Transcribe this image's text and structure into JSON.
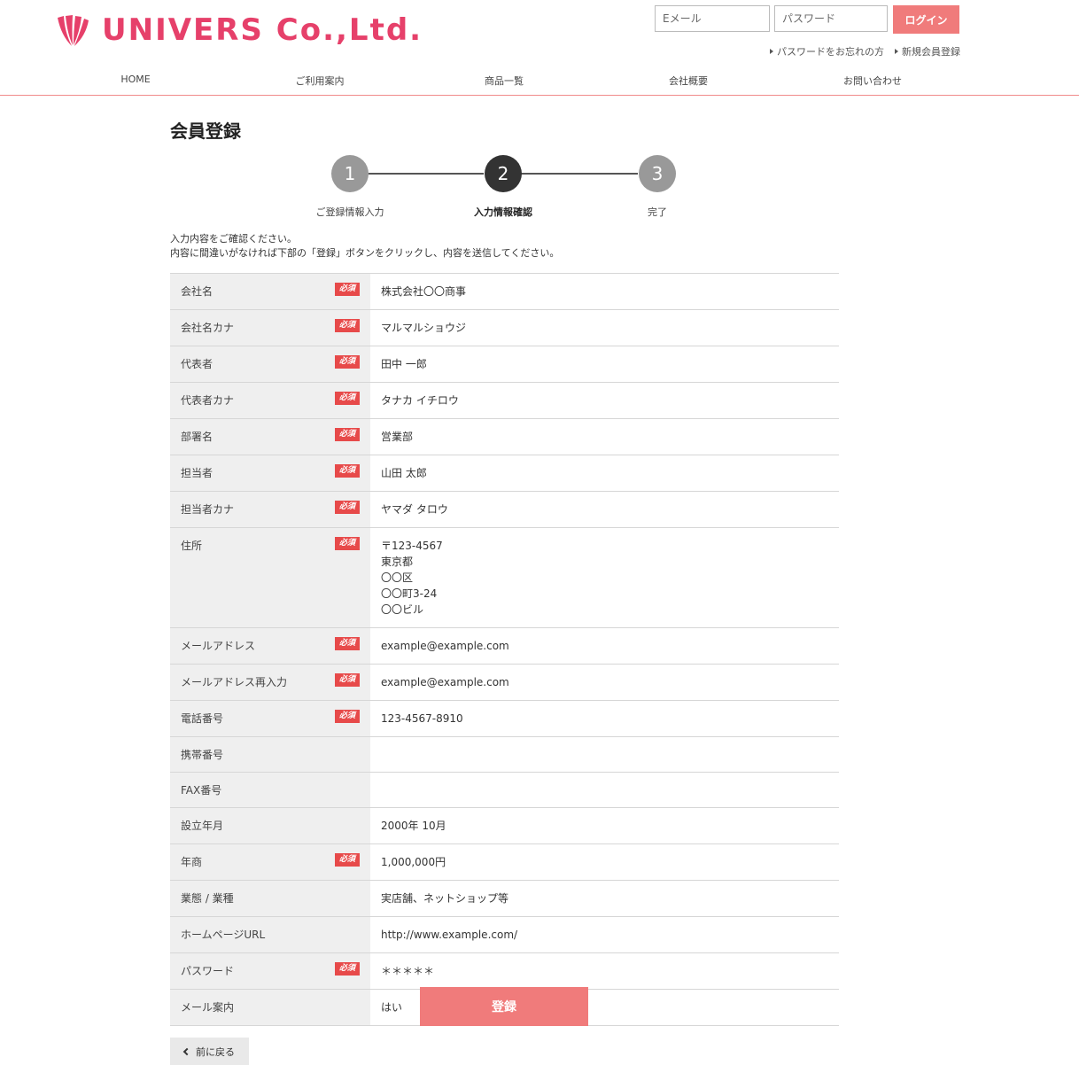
{
  "brand": {
    "logo_text": "UNIVERS Co.,Ltd.",
    "logo_icon": "fan-logo-icon",
    "brand_color": "#e6406a"
  },
  "login": {
    "email_placeholder": "Eメール",
    "password_placeholder": "パスワード",
    "button_label": "ログイン",
    "button_color": "#f07b7b"
  },
  "header_links": {
    "forgot_password": "パスワードをお忘れの方",
    "register": "新規会員登録"
  },
  "nav": [
    {
      "label": "HOME"
    },
    {
      "label": "ご利用案内"
    },
    {
      "label": "商品一覧"
    },
    {
      "label": "会社概要"
    },
    {
      "label": "お問い合わせ"
    }
  ],
  "page": {
    "title": "会員登録",
    "intro_line1": "入力内容をご確認ください。",
    "intro_line2": "内容に間違いがなければ下部の「登録」ボタンをクリックし、内容を送信してください。"
  },
  "steps": [
    {
      "number": "1",
      "label": "ご登録情報入力",
      "state": "done"
    },
    {
      "number": "2",
      "label": "入力情報確認",
      "state": "current"
    },
    {
      "number": "3",
      "label": "完了",
      "state": "upcoming"
    }
  ],
  "required_badge": "必須",
  "fields": [
    {
      "label": "会社名",
      "required": true,
      "value": "株式会社〇〇商事"
    },
    {
      "label": "会社名カナ",
      "required": true,
      "value": "マルマルショウジ"
    },
    {
      "label": "代表者",
      "required": true,
      "value": "田中 一郎"
    },
    {
      "label": "代表者カナ",
      "required": true,
      "value": "タナカ イチロウ"
    },
    {
      "label": "部署名",
      "required": true,
      "value": "営業部"
    },
    {
      "label": "担当者",
      "required": true,
      "value": "山田 太郎"
    },
    {
      "label": "担当者カナ",
      "required": true,
      "value": "ヤマダ タロウ"
    },
    {
      "label": "住所",
      "required": true,
      "value": [
        "〒123-4567",
        "東京都",
        "〇〇区",
        "〇〇町3-24",
        "〇〇ビル"
      ]
    },
    {
      "label": "メールアドレス",
      "required": true,
      "value": "example@example.com"
    },
    {
      "label": "メールアドレス再入力",
      "required": true,
      "value": "example@example.com"
    },
    {
      "label": "電話番号",
      "required": true,
      "value": "123-4567-8910"
    },
    {
      "label": "携帯番号",
      "required": false,
      "value": ""
    },
    {
      "label": "FAX番号",
      "required": false,
      "value": ""
    },
    {
      "label": "設立年月",
      "required": false,
      "value": "2000年 10月"
    },
    {
      "label": "年商",
      "required": true,
      "value": "1,000,000円"
    },
    {
      "label": "業態 / 業種",
      "required": false,
      "value": "実店舗、ネットショップ等"
    },
    {
      "label": "ホームページURL",
      "required": false,
      "value": "http://www.example.com/"
    },
    {
      "label": "パスワード",
      "required": true,
      "value": "＊＊＊＊＊"
    },
    {
      "label": "メール案内",
      "required": false,
      "value": "はい"
    }
  ],
  "actions": {
    "submit_label": "登録",
    "back_label": "前に戻る"
  }
}
